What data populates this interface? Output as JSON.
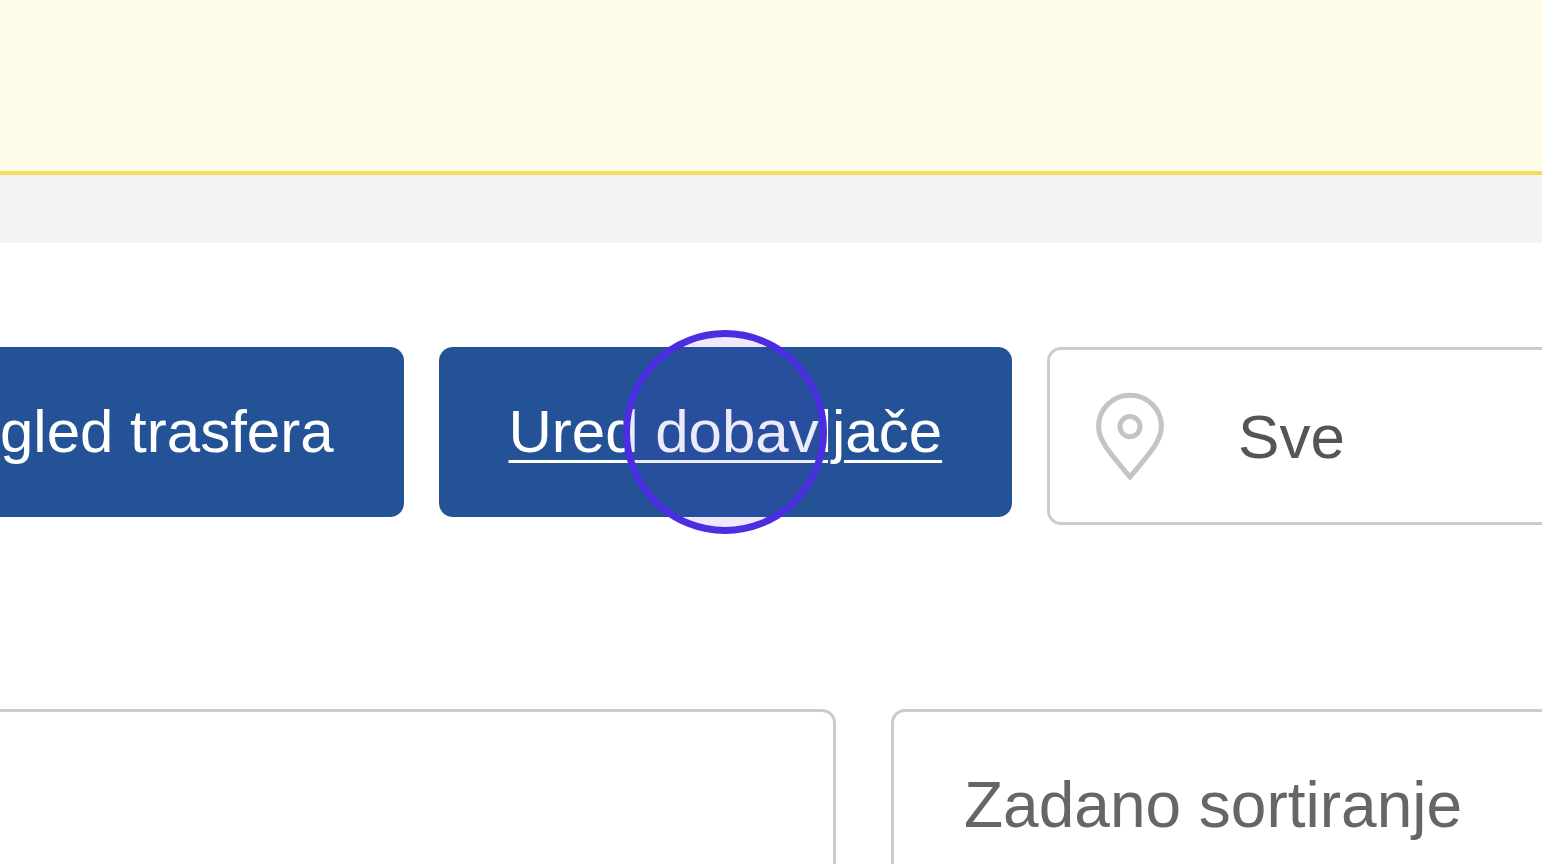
{
  "toolbar_buttons": [
    {
      "label": "gled trasfera",
      "hovered": false,
      "clicked": false
    },
    {
      "label": "Ured dobavljače",
      "hovered": true,
      "clicked": true
    }
  ],
  "location_filter": {
    "value": "Sve"
  },
  "sort_select": {
    "value": "Zadano sortiranje"
  }
}
